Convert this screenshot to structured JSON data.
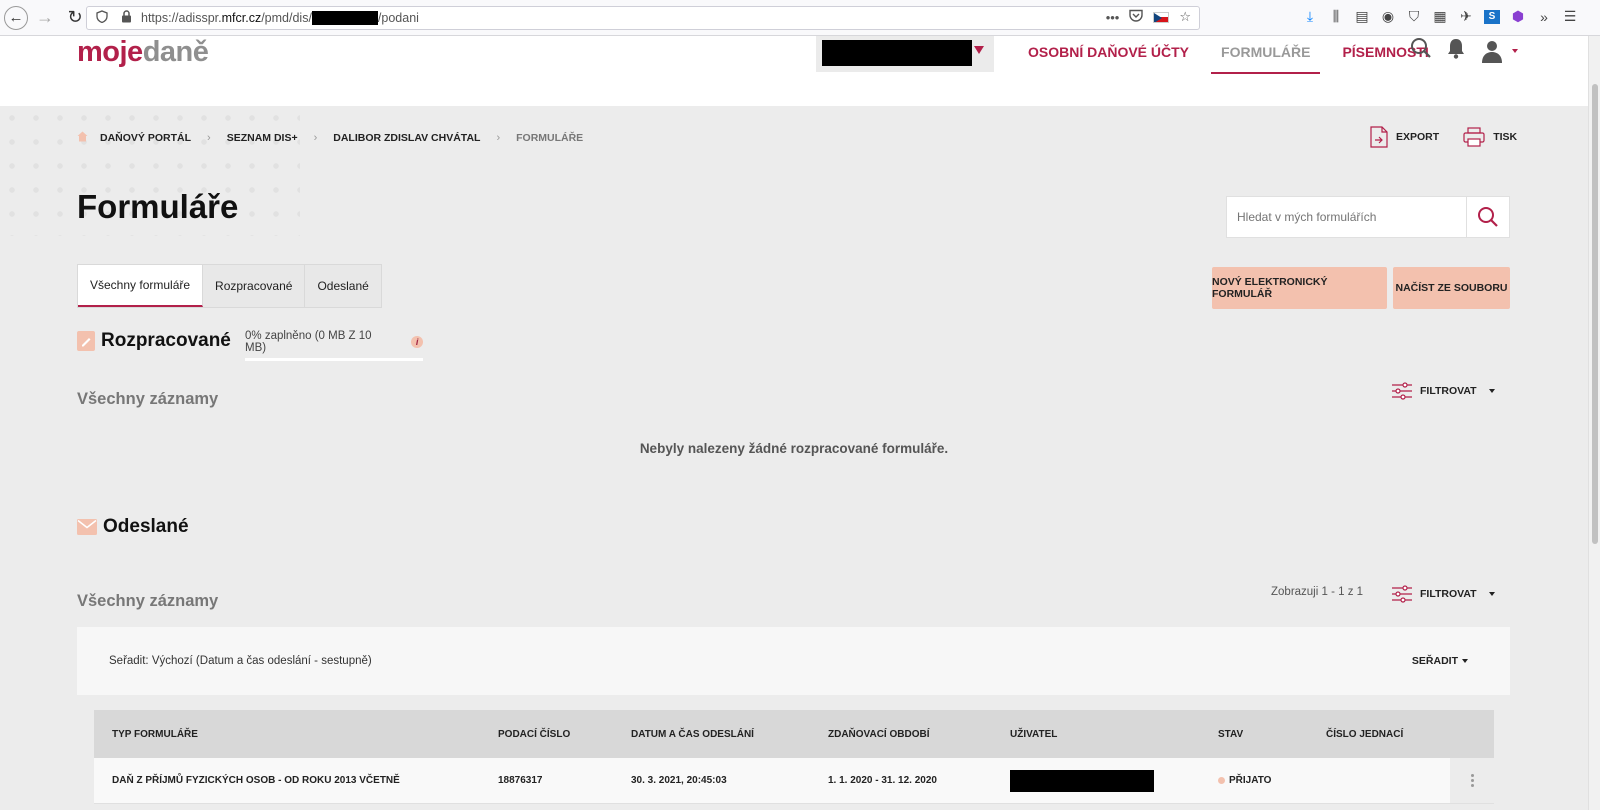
{
  "browser": {
    "url_prefix": "https://adisspr.",
    "url_host": "mfcr.cz",
    "url_path": "/pmd/dis/",
    "url_suffix": "/podani",
    "overflow_glyph": "•••",
    "extensions_more": "»",
    "menu_glyph": "☰"
  },
  "logo": {
    "part1": "moje",
    "part2": "daně"
  },
  "nav": {
    "items": [
      {
        "label": "OSOBNÍ DAŇOVÉ ÚČTY",
        "active": false
      },
      {
        "label": "FORMULÁŘE",
        "active": true
      },
      {
        "label": "PÍSEMNOSTI",
        "active": false
      }
    ]
  },
  "breadcrumb": {
    "items": [
      "DAŇOVÝ PORTÁL",
      "SEZNAM DIS+",
      "DALIBOR ZDISLAV CHVÁTAL",
      "FORMULÁŘE"
    ],
    "sep": "›"
  },
  "actions": {
    "export": "EXPORT",
    "print": "TISK"
  },
  "page": {
    "title": "Formuláře"
  },
  "search": {
    "placeholder": "Hledat v mých formulářích"
  },
  "tabs": [
    {
      "label": "Všechny formuláře",
      "active": true
    },
    {
      "label": "Rozpracované",
      "active": false
    },
    {
      "label": "Odeslané",
      "active": false
    }
  ],
  "buttons": {
    "new_form": "NOVÝ ELEKTRONICKÝ FORMULÁŘ",
    "load_file": "NAČÍST ZE SOUBORU"
  },
  "drafts": {
    "title": "Rozpracované",
    "storage": "0% zaplněno (0 MB Z 10 MB)",
    "info": "i",
    "subtitle": "Všechny záznamy",
    "filter": "FILTROVAT",
    "empty": "Nebyly nalezeny žádné rozpracované formuláře."
  },
  "sent": {
    "title": "Odeslané",
    "subtitle": "Všechny záznamy",
    "count": "Zobrazuji 1 - 1 z 1",
    "filter": "FILTROVAT",
    "sort_label": "Seřadit: Výchozí (Datum a čas odeslání - sestupně)",
    "sort_button": "SEŘADIT",
    "columns": [
      "TYP FORMULÁŘE",
      "PODACÍ ČÍSLO",
      "DATUM A ČAS ODESLÁNÍ",
      "ZDAŇOVACÍ OBDOBÍ",
      "UŽIVATEL",
      "STAV",
      "ČÍSLO JEDNACÍ"
    ],
    "rows": [
      {
        "type": "DAŇ Z PŘÍJMŮ FYZICKÝCH OSOB - OD ROKU 2013 VČETNĚ",
        "number": "18876317",
        "sent_at": "30. 3. 2021, 20:45:03",
        "period": "1. 1. 2020 - 31. 12. 2020",
        "status": "PŘIJATO",
        "ref": ""
      }
    ]
  },
  "colors": {
    "brand": "#b2204a",
    "peach": "#f3c1ae",
    "grey_bg": "#ececec"
  }
}
